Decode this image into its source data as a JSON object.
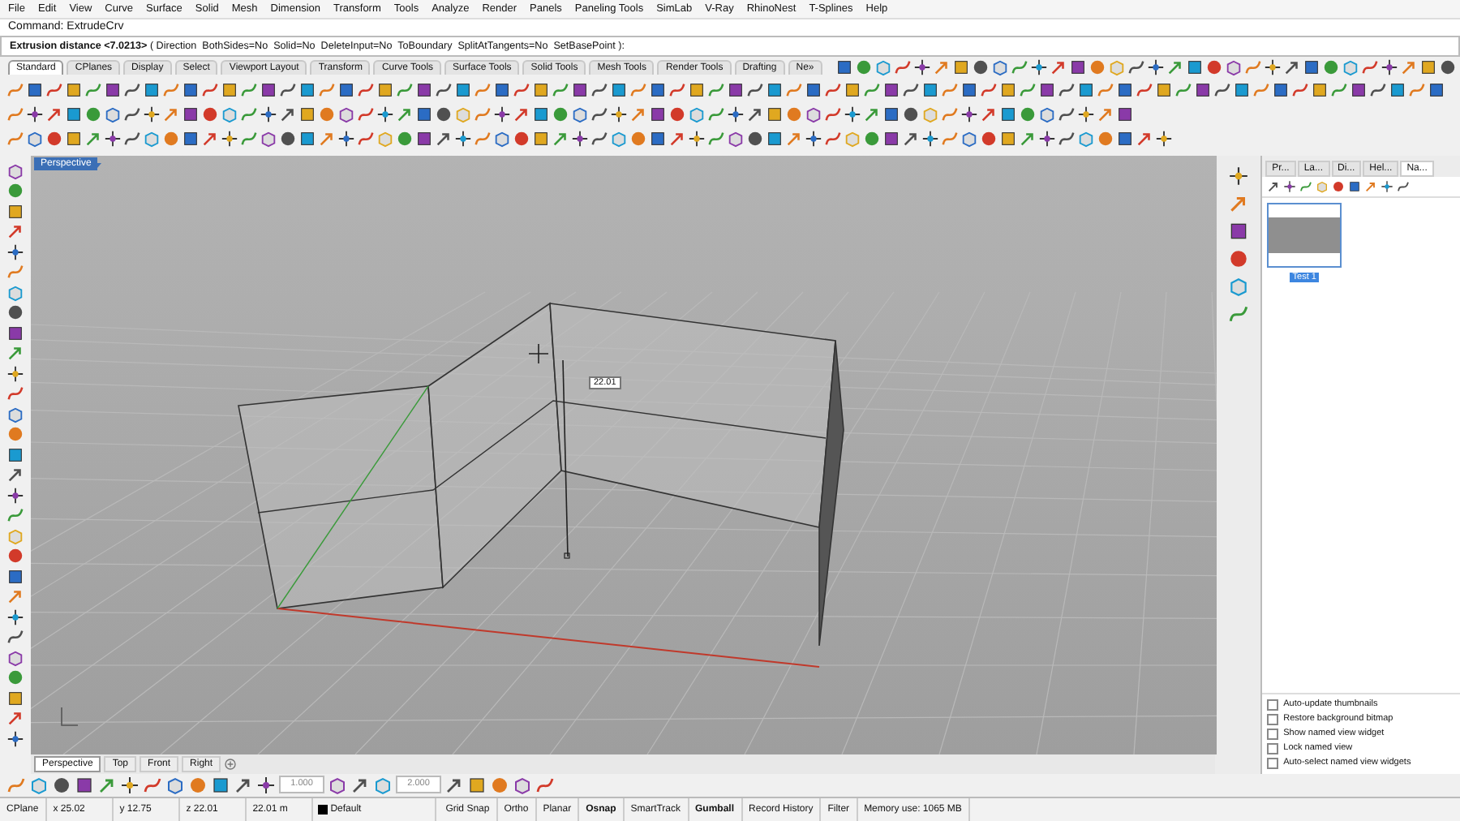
{
  "menu": [
    "File",
    "Edit",
    "View",
    "Curve",
    "Surface",
    "Solid",
    "Mesh",
    "Dimension",
    "Transform",
    "Tools",
    "Analyze",
    "Render",
    "Panels",
    "Paneling Tools",
    "SimLab",
    "V-Ray",
    "RhinoNest",
    "T-Splines",
    "Help"
  ],
  "command_history": "Command: ExtrudeCrv",
  "command_prompt": "**Extrusion distance <7.0213>** ( Direction  BothSides=No  Solid=No  DeleteInput=No  ToBoundary  SplitAtTangents=No  SetBasePoint ):",
  "toolbar_tabs": [
    {
      "label": "Standard",
      "selected": true
    },
    {
      "label": "CPlanes",
      "selected": false
    },
    {
      "label": "Display",
      "selected": false
    },
    {
      "label": "Select",
      "selected": false
    },
    {
      "label": "Viewport Layout",
      "selected": false
    },
    {
      "label": "Transform",
      "selected": false
    },
    {
      "label": "Curve Tools",
      "selected": false
    },
    {
      "label": "Surface Tools",
      "selected": false
    },
    {
      "label": "Solid Tools",
      "selected": false
    },
    {
      "label": "Mesh Tools",
      "selected": false
    },
    {
      "label": "Render Tools",
      "selected": false
    },
    {
      "label": "Drafting",
      "selected": false
    },
    {
      "label": "Ne»",
      "selected": false
    }
  ],
  "viewport": {
    "label": "Perspective",
    "tooltip": "22.01"
  },
  "viewport_tabs": [
    {
      "label": "Perspective",
      "selected": true
    },
    {
      "label": "Top",
      "selected": false
    },
    {
      "label": "Front",
      "selected": false
    },
    {
      "label": "Right",
      "selected": false
    }
  ],
  "panel": {
    "tabs": [
      {
        "label": "Pr...",
        "selected": false
      },
      {
        "label": "La...",
        "selected": false
      },
      {
        "label": "Di...",
        "selected": false
      },
      {
        "label": "Hel...",
        "selected": false
      },
      {
        "label": "Na...",
        "selected": true
      }
    ],
    "named_views": [
      {
        "label": "Test 1",
        "selected": true
      }
    ],
    "options": [
      {
        "label": "Auto-update thumbnails",
        "checked": false
      },
      {
        "label": "Restore background bitmap",
        "checked": false
      },
      {
        "label": "Show named view widget",
        "checked": false
      },
      {
        "label": "Lock named view",
        "checked": false
      },
      {
        "label": "Auto-select named view widgets",
        "checked": false
      }
    ]
  },
  "snap_inputs": [
    "1.000",
    "2.000"
  ],
  "status_bar": {
    "coordinates": [
      "CPlane",
      "x 25.02",
      "y 12.75",
      "z 22.01",
      "22.01 m"
    ],
    "layer": "Default",
    "toggles": [
      {
        "label": "Grid Snap",
        "on": false
      },
      {
        "label": "Ortho",
        "on": false
      },
      {
        "label": "Planar",
        "on": false
      },
      {
        "label": "Osnap",
        "on": true
      },
      {
        "label": "SmartTrack",
        "on": false
      },
      {
        "label": "Gumball",
        "on": true
      },
      {
        "label": "Record History",
        "on": false
      },
      {
        "label": "Filter",
        "on": false
      }
    ],
    "memory": "Memory use: 1065 MB"
  }
}
